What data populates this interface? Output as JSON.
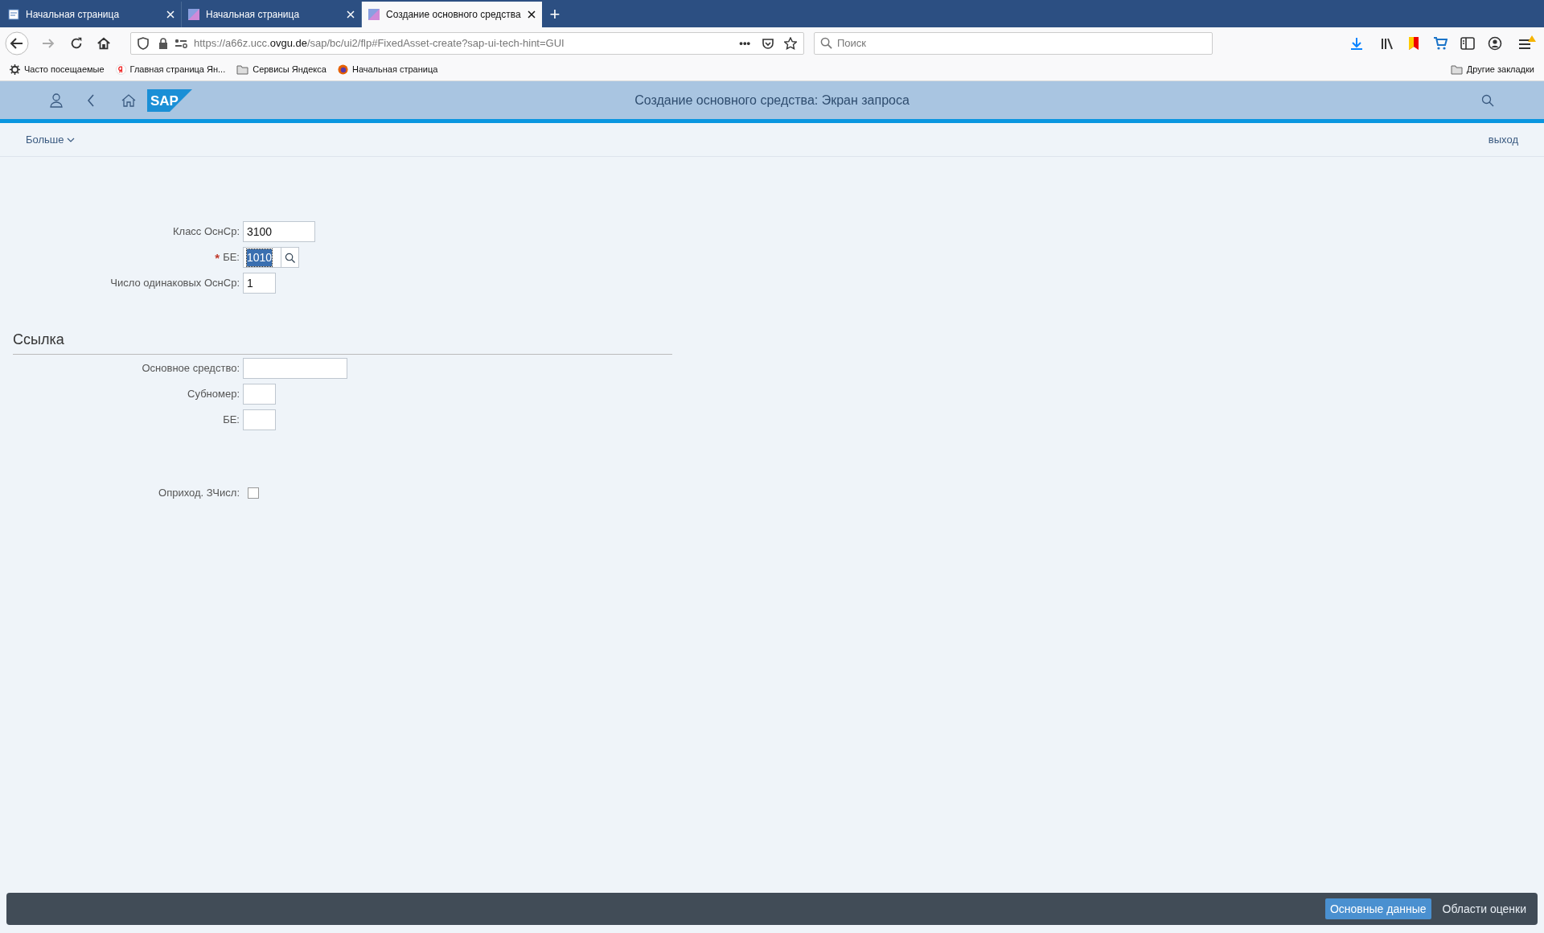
{
  "browser": {
    "tabs": [
      {
        "title": "Начальная страница",
        "selected": false,
        "kind": "doc"
      },
      {
        "title": "Начальная страница",
        "selected": false,
        "kind": "sap"
      },
      {
        "title": "Создание основного средства",
        "selected": true,
        "kind": "sap"
      }
    ],
    "new_tab": "+",
    "url": {
      "prefix": "https://a66z.ucc.",
      "domain": "ovgu.de",
      "path": "/sap/bc/ui2/flp#FixedAsset-create?sap-ui-tech-hint=GUI"
    },
    "page_actions": "•••",
    "search": {
      "placeholder": "Поиск"
    },
    "bookmarks": [
      {
        "label": "Часто посещаемые",
        "kind": "gear"
      },
      {
        "label": "Главная страница Ян...",
        "kind": "yandex"
      },
      {
        "label": "Сервисы Яндекса",
        "kind": "folder"
      },
      {
        "label": "Начальная страница",
        "kind": "firefox"
      }
    ],
    "other_bookmarks": "Другие закладки"
  },
  "app": {
    "logo": "SAP",
    "required_symbol": "*",
    "title": "Создание основного средства: Экран запроса",
    "menu": "Больше",
    "exit": "выход",
    "fields": [
      {
        "label": "Класс ОснСр:",
        "value": "3100",
        "kind": "medium",
        "required": false,
        "highlighted": false
      },
      {
        "label": "БЕ:",
        "value": "1010",
        "kind": "lookup",
        "required": true,
        "highlighted": true
      },
      {
        "label": "Число одинаковых ОснСр:",
        "value": "1",
        "kind": "short",
        "required": false,
        "highlighted": false
      }
    ],
    "section": {
      "title": "Ссылка",
      "fields": [
        {
          "label": "Основное средство:",
          "kind": "long"
        },
        {
          "label": "Субномер:",
          "kind": "short"
        },
        {
          "label": "БЕ:",
          "kind": "short"
        }
      ]
    },
    "checkbox": {
      "label": "Оприход. ЗЧисл:",
      "checked": false
    },
    "footer_buttons": [
      {
        "label": "Основные данные",
        "emphasized": true
      },
      {
        "label": "Области оценки",
        "emphasized": false
      }
    ]
  }
}
